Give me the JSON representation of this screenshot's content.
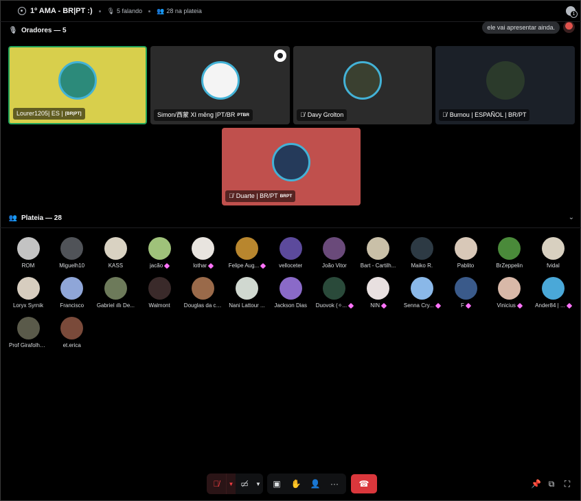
{
  "header": {
    "title": "1º AMA - BR|PT :)",
    "speaking": "5 falando",
    "audience_count": "28 na plateia"
  },
  "speakers_section": {
    "label": "Oradores — 5"
  },
  "bubble": {
    "text": "ele vai apresentar ainda."
  },
  "speakers": [
    {
      "name": "Lourer1205| ES |",
      "tag": "[BR|PT]",
      "muted": false,
      "bg": "#d8cf4c",
      "avatar_color": "#2c8a7a"
    },
    {
      "name": "Simon/西蒙 XI mēng |PT/BR",
      "tag": "PTBR",
      "muted": false,
      "bg": "#2b2b2b",
      "avatar_color": "#f4f4f4"
    },
    {
      "name": "Davy Grolton",
      "tag": "",
      "muted": true,
      "bg": "#2b2b2b",
      "avatar_color": "#3a4030"
    },
    {
      "name": "Burnou | ESPAÑOL | BR/PT",
      "tag": "",
      "muted": true,
      "bg": "#1b2028",
      "avatar_color": "#2b3a2b"
    },
    {
      "name": "Duarte | BR/PT",
      "tag": "BRPT",
      "muted": true,
      "bg": "#c0504d",
      "avatar_color": "#253a5a"
    }
  ],
  "audience_section": {
    "label": "Plateia — 28"
  },
  "audience": [
    {
      "name": "ROM",
      "color": "#c3c3c3",
      "boost": false
    },
    {
      "name": "Miguelh10",
      "color": "#505358",
      "boost": false
    },
    {
      "name": "KASS",
      "color": "#d9d2c2",
      "boost": false
    },
    {
      "name": "jacão",
      "color": "#9fc27a",
      "boost": true
    },
    {
      "name": "lothar",
      "color": "#e8e4df",
      "boost": true
    },
    {
      "name": "Felipe Aug...",
      "color": "#b8862e",
      "boost": true
    },
    {
      "name": "velloceter",
      "color": "#5c4a9c",
      "boost": false
    },
    {
      "name": "João Vitor",
      "color": "#6a4a7a",
      "boost": false
    },
    {
      "name": "Bart - Cartilh...",
      "color": "#c9c0a8",
      "boost": false
    },
    {
      "name": "Maiko R.",
      "color": "#2d3a44",
      "boost": false
    },
    {
      "name": "Pablito",
      "color": "#d8c8b8",
      "boost": false
    },
    {
      "name": "BrZeppelin",
      "color": "#4a8a3a",
      "boost": false
    },
    {
      "name": "fvidal",
      "color": "#d8d0c0",
      "boost": false
    },
    {
      "name": "Loryx Syrnik",
      "color": "#d7cdbf",
      "boost": false
    },
    {
      "name": "Francisco",
      "color": "#8fa6d8",
      "boost": false
    },
    {
      "name": "Gabriel ıllı De...",
      "color": "#6d7a5a",
      "boost": false
    },
    {
      "name": "Walmont",
      "color": "#3a2a2a",
      "boost": false
    },
    {
      "name": "Douglas da co...",
      "color": "#9a6a4a",
      "boost": false
    },
    {
      "name": "Nani Lattour ...",
      "color": "#d0d8d0",
      "boost": false
    },
    {
      "name": "Jackson Dias",
      "color": "#8a6ac8",
      "boost": false
    },
    {
      "name": "Duovok (✧...",
      "color": "#2a4a3a",
      "boost": true
    },
    {
      "name": "NIN",
      "color": "#e8e0e0",
      "boost": true
    },
    {
      "name": "Senna Cry...",
      "color": "#8ab8e8",
      "boost": true
    },
    {
      "name": "F",
      "color": "#3a5a8a",
      "boost": true
    },
    {
      "name": "Vinicius",
      "color": "#d8b8a8",
      "boost": true
    },
    {
      "name": "Ander84 | ...",
      "color": "#4aa8d8",
      "boost": true
    },
    {
      "name": "Prof Girafolhe...",
      "color": "#5a5a4a",
      "boost": false
    },
    {
      "name": "et.erica",
      "color": "#7a4a3a",
      "boost": false
    }
  ],
  "icons": {
    "stage": "stage-icon",
    "mic": "microphone-icon",
    "audience": "audience-icon",
    "chevron": "chevron-down-icon",
    "leave": "phone-hangup-icon"
  },
  "colors": {
    "accent_green": "#23a55a",
    "danger": "#da373c",
    "boost": "#ff73fa"
  }
}
